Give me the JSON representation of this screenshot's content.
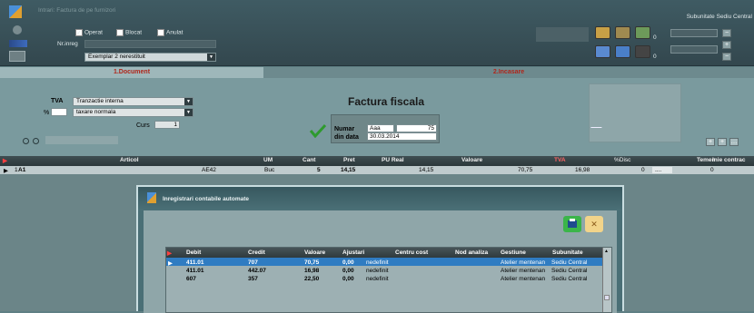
{
  "topbar": {
    "title": "Intrari: Factura de pe furnizori",
    "checks": [
      {
        "label": "Operat",
        "checked": true
      },
      {
        "label": "Blocat",
        "checked": false
      },
      {
        "label": "Anulat",
        "checked": false
      }
    ],
    "nr_inreg_label": "Nr.inreg",
    "exemplar_value": "Exemplar 2 nerestituit",
    "subunit_title": "Subunitate Sediu Central",
    "btn_suffix_1": "0",
    "btn_suffix_2": "0"
  },
  "tabs": {
    "document": "1.Document",
    "incasare": "2.Incasare"
  },
  "form": {
    "tva_label": "TVA",
    "tva_value": "Tranzactie interna",
    "pct_label": "%",
    "tva_type_value": "taxare normala",
    "curs_label": "Curs",
    "curs_value": "1",
    "invoice_title": "Factura fiscala",
    "numar_label": "Numar",
    "serie_value": "Aaa",
    "numar_value": "75",
    "data_label": "din data",
    "data_value": "30.03.2014"
  },
  "grid": {
    "headers": [
      "Articol",
      "UM",
      "Cant",
      "Pret",
      "PU Real",
      "Valoare",
      "TVA",
      "%Disc",
      "Temen",
      "inie contrac"
    ],
    "rows": [
      {
        "nr": "1",
        "articol": "A1",
        "cod": "AE42",
        "um": "Buc",
        "cant": "5",
        "pret": "14,15",
        "pu_real": "14,15",
        "valoare": "70,75",
        "tva": "16,98",
        "disc": "0",
        "dots": "....",
        "temen": "0"
      }
    ]
  },
  "dialog": {
    "title": "Inregistrari contabile automate",
    "print_icon": "printer-icon",
    "close_icon": "close-icon",
    "columns": [
      "Debit",
      "Credit",
      "Valoare",
      "Ajustari",
      "Centru cost",
      "Nod analiza",
      "Gestiune",
      "Subunitate"
    ],
    "rows": [
      {
        "debit": "411.01",
        "credit": "707",
        "valoare": "70,75",
        "ajustari": "0,00",
        "centru": "nedefinit",
        "nod": "",
        "gestiune": "Atelier mentenan",
        "subunitate": "Sediu Central"
      },
      {
        "debit": "411.01",
        "credit": "442.07",
        "valoare": "16,98",
        "ajustari": "0,00",
        "centru": "nedefinit",
        "nod": "",
        "gestiune": "Atelier mentenan",
        "subunitate": "Sediu Central"
      },
      {
        "debit": "607",
        "credit": "357",
        "valoare": "22,50",
        "ajustari": "0,00",
        "centru": "nedefinit",
        "nod": "",
        "gestiune": "Atelier mentenan",
        "subunitate": "Sediu Central"
      }
    ],
    "selected_row": 0
  },
  "colors": {
    "accent_red": "#c0392b",
    "selected_row": "#2f7cc2",
    "check_green": "#2e9a2e"
  }
}
